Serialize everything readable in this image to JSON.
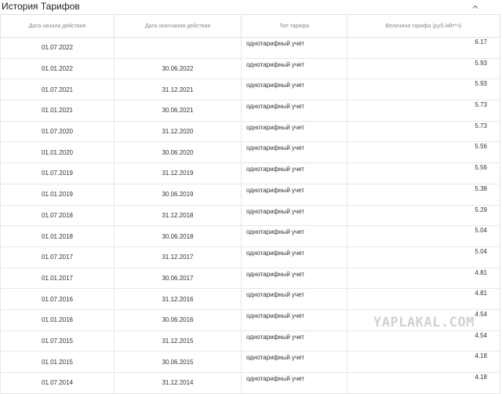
{
  "panel": {
    "title": "История Тарифов",
    "collapse_icon": "chevron-up-icon"
  },
  "table": {
    "headers": [
      "Дата начала действия",
      "Дата окончания действия",
      "Тип тарифа",
      "Величина тарифа (руб./кВт*ч)"
    ],
    "rows": [
      {
        "start": "01.07.2022",
        "end": "",
        "type": "однотарифный учет",
        "value": "6.17"
      },
      {
        "start": "01.01.2022",
        "end": "30.06.2022",
        "type": "однотарифный учет",
        "value": "5.93"
      },
      {
        "start": "01.07.2021",
        "end": "31.12.2021",
        "type": "однотарифный учет",
        "value": "5.93"
      },
      {
        "start": "01.01.2021",
        "end": "30.06.2021",
        "type": "однотарифный учет",
        "value": "5.73"
      },
      {
        "start": "01.07.2020",
        "end": "31.12.2020",
        "type": "однотарифный учет",
        "value": "5.73"
      },
      {
        "start": "01.01.2020",
        "end": "30.06.2020",
        "type": "однотарифный учет",
        "value": "5.56"
      },
      {
        "start": "01.07.2019",
        "end": "31.12.2019",
        "type": "однотарифный учет",
        "value": "5.56"
      },
      {
        "start": "01.01.2019",
        "end": "30.06.2019",
        "type": "однотарифный учет",
        "value": "5.38"
      },
      {
        "start": "01.07.2018",
        "end": "31.12.2018",
        "type": "однотарифный учет",
        "value": "5.29"
      },
      {
        "start": "01.01.2018",
        "end": "30.06.2018",
        "type": "однотарифный учет",
        "value": "5.04"
      },
      {
        "start": "01.07.2017",
        "end": "31.12.2017",
        "type": "однотарифный учет",
        "value": "5.04"
      },
      {
        "start": "01.01.2017",
        "end": "30.06.2017",
        "type": "однотарифный учет",
        "value": "4.81"
      },
      {
        "start": "01.07.2016",
        "end": "31.12.2016",
        "type": "однотарифный учет",
        "value": "4.81"
      },
      {
        "start": "01.01.2016",
        "end": "30.06.2016",
        "type": "однотарифный учет",
        "value": "4.54"
      },
      {
        "start": "01.07.2015",
        "end": "31.12.2015",
        "type": "однотарифный учет",
        "value": "4.54"
      },
      {
        "start": "01.01.2015",
        "end": "30.06.2015",
        "type": "однотарифный учет",
        "value": "4.18"
      },
      {
        "start": "01.07.2014",
        "end": "31.12.2014",
        "type": "однотарифный учет",
        "value": "4.18"
      }
    ]
  },
  "watermark": "YAPLAKAL.COM",
  "colors": {
    "border": "#e2e2e2",
    "header_text": "#8a8a8a",
    "watermark": "#c9c9c9"
  }
}
